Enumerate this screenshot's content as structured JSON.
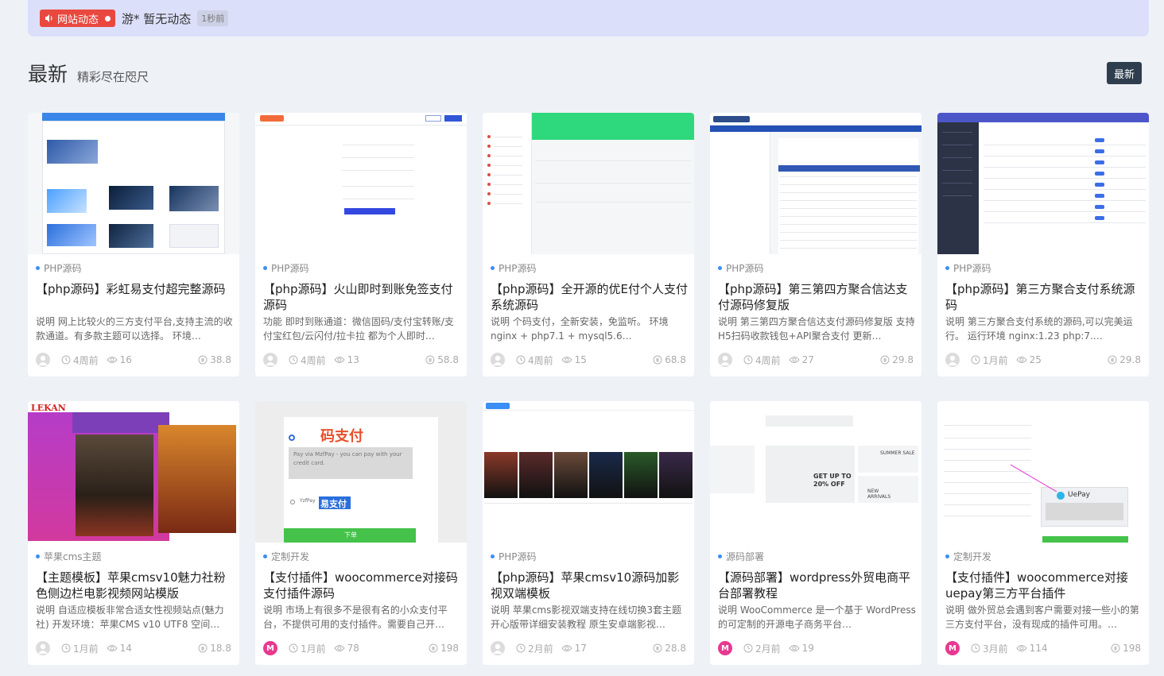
{
  "notice": {
    "tag_label": "网站动态",
    "text": "游* 暂无动态",
    "time": "1秒前"
  },
  "section": {
    "title": "最新",
    "subtitle": "精彩尽在咫尺",
    "button_label": "最新"
  },
  "colors": {
    "accent": "#3a8ef6",
    "notice_bg": "#dcdffa",
    "tag_red": "#e9483f",
    "button_dark": "#2f3e4f"
  },
  "cards": [
    {
      "category": "PHP源码",
      "title": "【php源码】彩虹易支付超完整源码",
      "desc": "说明 网上比较火的三方支付平台,支持主流的收款通道。有多款主题可以选择。 环境…",
      "time": "4周前",
      "views": "16",
      "comments": "38.8",
      "avatar": "default",
      "thumb_style": "rainbow-pay"
    },
    {
      "category": "PHP源码",
      "title": "【php源码】火山即时到账免签支付源码",
      "desc": "功能 即时到账通道：微信固码/支付宝转账/支付宝红包/云闪付/拉卡拉 都为个人即时…",
      "time": "4周前",
      "views": "13",
      "comments": "58.8",
      "avatar": "default",
      "thumb_style": "volcano-pay"
    },
    {
      "category": "PHP源码",
      "title": "【php源码】全开源的优E付个人支付系统源码",
      "desc": "说明 个码支付，全新安装，免监听。 环境 nginx + php7.1 + mysql5.6…",
      "time": "4周前",
      "views": "15",
      "comments": "68.8",
      "avatar": "default",
      "thumb_style": "youe-pay"
    },
    {
      "category": "PHP源码",
      "title": "【php源码】第三第四方聚合信达支付源码修复版",
      "desc": "说明 第三第四方聚合信达支付源码修复版 支持H5扫码收款钱包+API聚合支付 更新…",
      "time": "4周前",
      "views": "27",
      "comments": "29.8",
      "avatar": "default",
      "thumb_style": "xinda-pay"
    },
    {
      "category": "PHP源码",
      "title": "【php源码】第三方聚合支付系统源码",
      "desc": "说明 第三方聚合支付系统的源码,可以完美运行。 运行环境 nginx:1.23 php:7.…",
      "time": "1月前",
      "views": "25",
      "comments": "29.8",
      "avatar": "default",
      "thumb_style": "aggregate-pay"
    },
    {
      "category": "苹果cms主题",
      "title": "【主题模板】苹果cmsv10魅力社粉色侧边栏电影视频网站模版",
      "desc": "说明 自适应模板非常合适女性视频站点(魅力社) 开发环境：苹果CMS v10 UTF8 空间…",
      "time": "1月前",
      "views": "14",
      "comments": "18.8",
      "avatar": "default",
      "thumb_style": "lekan"
    },
    {
      "category": "定制开发",
      "title": "【支付插件】woocommerce对接码支付插件源码",
      "desc": "说明 市场上有很多不是很有名的小众支付平台，不提供可用的支付插件。需要自己开…",
      "time": "1月前",
      "views": "78",
      "comments": "198",
      "avatar": "m",
      "thumb_style": "mazhifu",
      "thumb_text": {
        "brand_1": "码支付",
        "brand_2": "易支付",
        "pay_line": "Pay via MzfPay - you can pay with your credit card.",
        "option_1": "MzfPay",
        "option_2": "YzfPay",
        "submit": "下单"
      }
    },
    {
      "category": "PHP源码",
      "title": "【php源码】苹果cmsv10源码加影视双端模板",
      "desc": "说明 苹果cms影视双端支持在线切换3套主题开心版带详细安装教程 原生安卓端影视…",
      "time": "2月前",
      "views": "17",
      "comments": "28.8",
      "avatar": "default",
      "thumb_style": "ysxinan"
    },
    {
      "category": "源码部署",
      "title": "【源码部署】wordpress外贸电商平台部署教程",
      "desc": "说明 WooCommerce 是一个基于 WordPress 的可定制的开源电子商务平台…",
      "time": "2月前",
      "views": "19",
      "comments": "",
      "avatar": "m",
      "thumb_style": "wp-shop",
      "thumb_text": {
        "offer": "GET UP TO 20% OFF",
        "sale": "SUMMER SALE",
        "arrivals": "NEW ARRIVALS"
      }
    },
    {
      "category": "定制开发",
      "title": "【支付插件】woocommerce对接uepay第三方平台插件",
      "desc": "说明 做外贸总会遇到客户需要对接一些小的第三方支付平台，没有现成的插件可用。…",
      "time": "3月前",
      "views": "114",
      "comments": "198",
      "avatar": "m",
      "thumb_style": "uepay",
      "thumb_text": {
        "brand": "UePay"
      }
    }
  ],
  "icons": {
    "notice": "speaker-icon",
    "time": "clock-icon",
    "views": "eye-icon",
    "comments": "coin-icon"
  }
}
